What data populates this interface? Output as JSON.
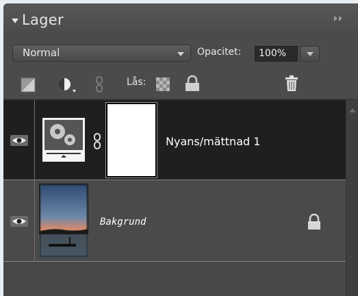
{
  "panel": {
    "title": "Lager",
    "collapse_icon": "triangle-down-icon",
    "menu_icon": "double-chevron-right-icon"
  },
  "toolbar": {
    "blend_mode": "Normal",
    "opacity_label": "Opacitet:",
    "opacity_value": "100%",
    "lock_label": "Lås:"
  },
  "layers": [
    {
      "name": "Nyans/mättnad 1",
      "kind": "adjustment",
      "visible": true,
      "selected": true
    },
    {
      "name": "Bakgrund",
      "kind": "image",
      "visible": true,
      "locked": true,
      "selected": false
    }
  ],
  "colors": {
    "panel_bg": "#4b4b4b",
    "selected_row_bg": "#1f1f1f",
    "text": "#e8e8e8"
  }
}
